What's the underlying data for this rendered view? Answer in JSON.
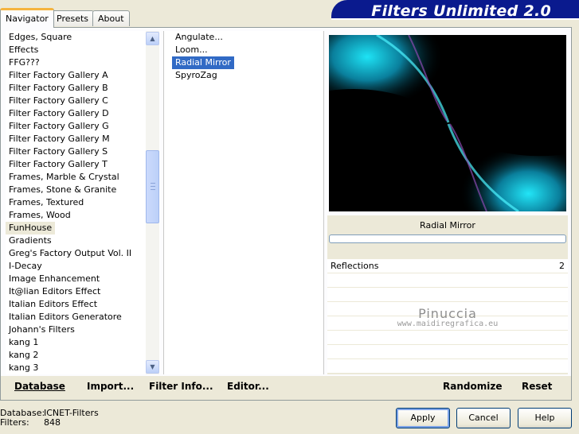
{
  "app": {
    "title": "Filters Unlimited 2.0"
  },
  "tabs": [
    {
      "label": "Navigator",
      "active": true
    },
    {
      "label": "Presets",
      "active": false
    },
    {
      "label": "About",
      "active": false
    }
  ],
  "categories": [
    "Edges, Square",
    "Effects",
    "FFG???",
    "Filter Factory Gallery A",
    "Filter Factory Gallery B",
    "Filter Factory Gallery C",
    "Filter Factory Gallery D",
    "Filter Factory Gallery G",
    "Filter Factory Gallery M",
    "Filter Factory Gallery S",
    "Filter Factory Gallery T",
    "Frames, Marble & Crystal",
    "Frames, Stone & Granite",
    "Frames, Textured",
    "Frames, Wood",
    "FunHouse",
    "Gradients",
    "Greg's Factory Output Vol. II",
    "I-Decay",
    "Image Enhancement",
    "It@lian Editors Effect",
    "Italian Editors Effect",
    "Italian Editors Generatore",
    "Johann's Filters",
    "kang 1",
    "kang 2",
    "kang 3"
  ],
  "selected_category": "FunHouse",
  "filters": [
    "Angulate...",
    "Loom...",
    "Radial Mirror",
    "SpyroZag"
  ],
  "selected_filter": "Radial Mirror",
  "preview": {
    "filter_name": "Radial Mirror"
  },
  "parameters": [
    {
      "label": "Reflections",
      "value": "2"
    }
  ],
  "watermark": {
    "line1": "Pinuccia",
    "line2": "www.maidiregrafica.eu"
  },
  "toolbar": {
    "database": "Database",
    "import": "Import...",
    "filter_info": "Filter Info...",
    "editor": "Editor...",
    "randomize": "Randomize",
    "reset": "Reset"
  },
  "status": {
    "database_label": "Database:",
    "database_value": "ICNET-Filters",
    "filters_label": "Filters:",
    "filters_value": "848"
  },
  "buttons": {
    "apply": "Apply",
    "cancel": "Cancel",
    "help": "Help"
  },
  "colors": {
    "banner": "#0a1a8e",
    "selection": "#316ac5",
    "accent_tab": "#f5b43e"
  }
}
